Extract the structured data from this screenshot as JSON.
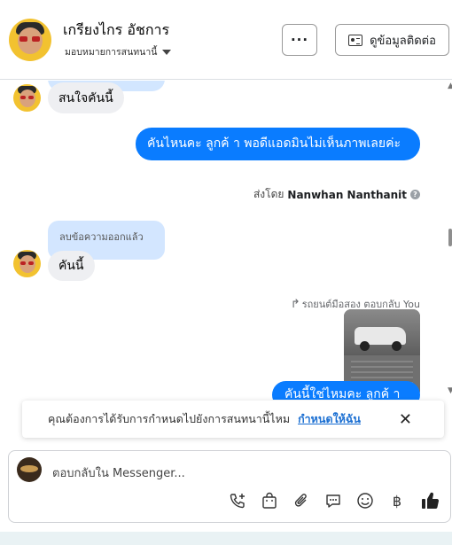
{
  "header": {
    "name": "เกรียงไกร อัชการ",
    "assign_label": "มอบหมายการสนทนานี้",
    "more_label": "···",
    "contact_label": "ดูข้อมูลติดต่อ"
  },
  "messages": {
    "m1_text": "สนใจคันนี้",
    "m2_text": "คันไหนคะ  ลูกค้ า  พอดีแอดมินไม่เห็นภาพเลยค่ะ",
    "sent_by_prefix": "ส่งโดย",
    "sent_by_name": "Nanwhan Nanthanit",
    "deleted_text": "ลบข้อความออกแล้ว",
    "m3_text": "คันนี้",
    "reply_label": "รถยนต์มือสอง ตอบกลับ You",
    "m4_text": "คันนี้ใช่ไหมคะ  ลูกค้ า"
  },
  "notice": {
    "text": "คุณต้องการได้รับการกำหนดไปยังการสนทนานี้ไหม",
    "link": "กำหนดให้ฉัน",
    "close": "✕"
  },
  "composer": {
    "placeholder": "ตอบกลับใน Messenger...",
    "icons": [
      "phone-plus-icon",
      "bag-icon",
      "paperclip-icon",
      "chat-icon",
      "emoji-icon",
      "baht-icon",
      "thumbs-up-icon"
    ]
  },
  "colors": {
    "outgoing": "#0a7cff",
    "incoming": "#eeeff2",
    "deleted_bubble": "#d3e6ff",
    "link": "#1b6fd2"
  }
}
